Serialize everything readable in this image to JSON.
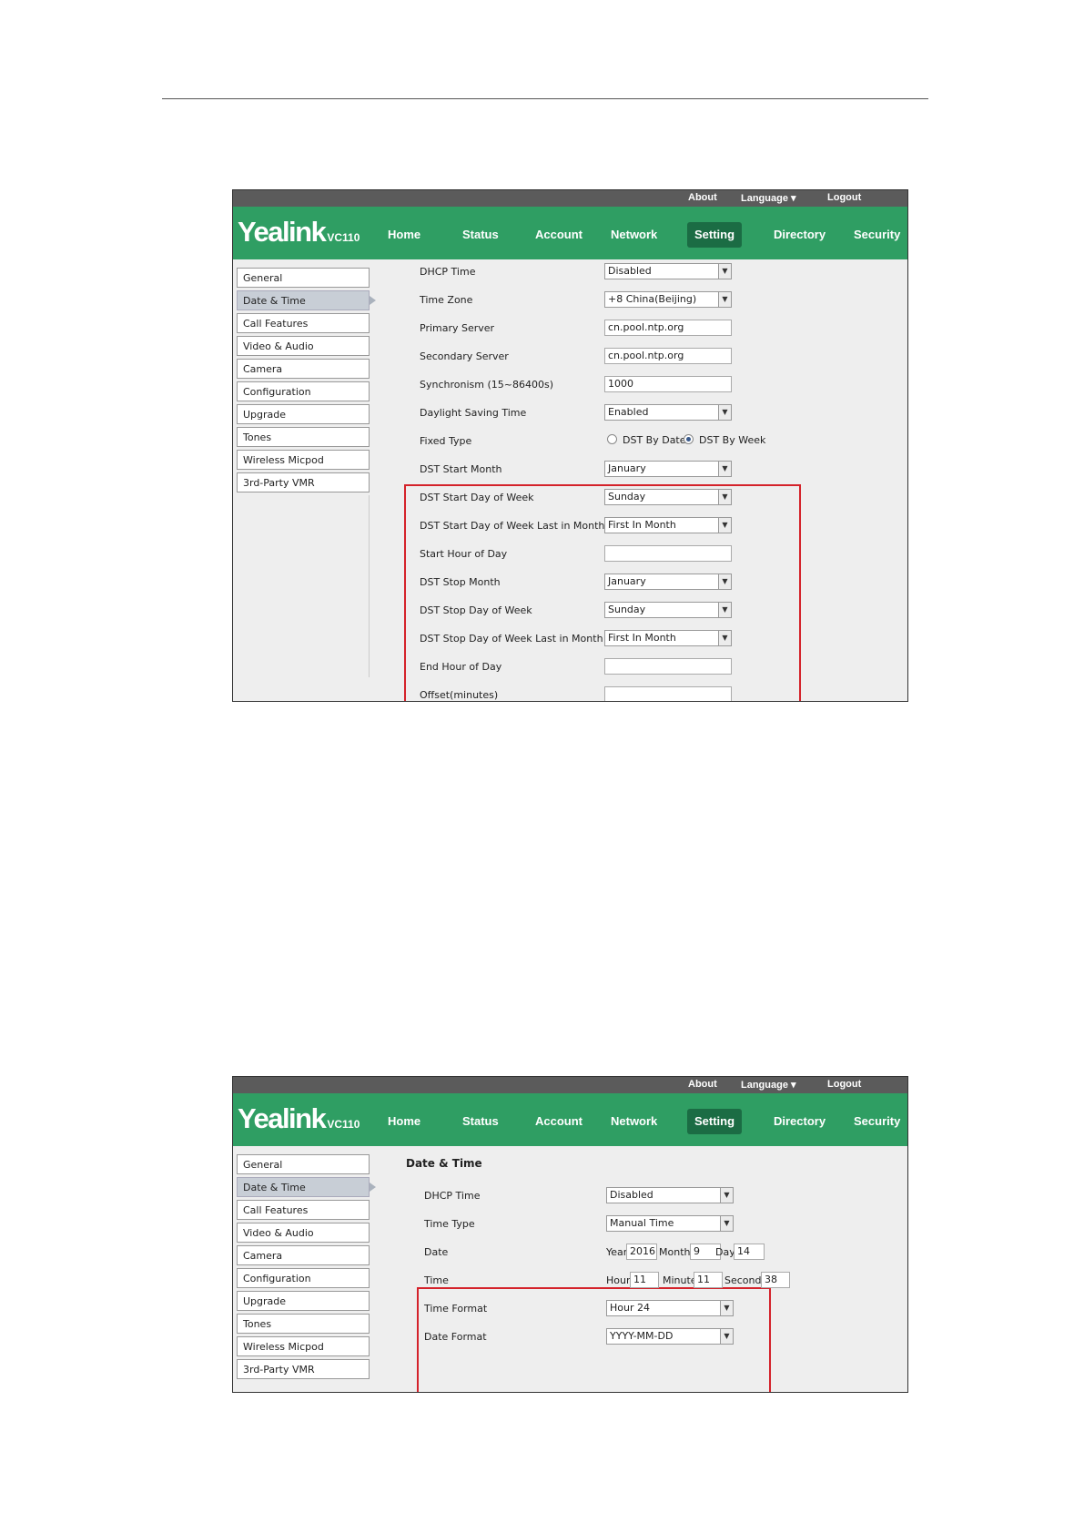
{
  "screenshots": [
    {
      "topbar": {
        "about": "About",
        "language": "Language ▾",
        "logout": "Logout"
      },
      "brand": {
        "logo": "Yealink",
        "model": "VC110"
      },
      "nav": [
        "Home",
        "Status",
        "Account",
        "Network",
        "Setting",
        "Directory",
        "Security"
      ],
      "active_nav": "Setting",
      "sidebar": [
        "General",
        "Date & Time",
        "Call Features",
        "Video & Audio",
        "Camera",
        "Configuration",
        "Upgrade",
        "Tones",
        "Wireless Micpod",
        "3rd-Party VMR"
      ],
      "active_sidebar": "Date & Time",
      "form": {
        "dhcp_time": {
          "label": "DHCP Time",
          "value": "Disabled"
        },
        "time_zone": {
          "label": "Time Zone",
          "value": "+8 China(Beijing)"
        },
        "primary_server": {
          "label": "Primary Server",
          "value": "cn.pool.ntp.org"
        },
        "secondary_server": {
          "label": "Secondary Server",
          "value": "cn.pool.ntp.org"
        },
        "synchronism": {
          "label": "Synchronism (15~86400s)",
          "value": "1000"
        },
        "daylight_saving": {
          "label": "Daylight Saving Time",
          "value": "Enabled"
        },
        "fixed_type": {
          "label": "Fixed Type",
          "option_date": "DST By Date",
          "option_week": "DST By Week",
          "selected": "DST By Week"
        },
        "dst_start_month": {
          "label": "DST Start Month",
          "value": "January"
        },
        "dst_start_dow": {
          "label": "DST Start Day of Week",
          "value": "Sunday"
        },
        "dst_start_dow_last": {
          "label": "DST Start Day of Week Last in Month",
          "value": "First In Month"
        },
        "start_hour": {
          "label": "Start Hour of Day",
          "value": ""
        },
        "dst_stop_month": {
          "label": "DST Stop Month",
          "value": "January"
        },
        "dst_stop_dow": {
          "label": "DST Stop Day of Week",
          "value": "Sunday"
        },
        "dst_stop_dow_last": {
          "label": "DST Stop Day of Week Last in Month",
          "value": "First In Month"
        },
        "end_hour": {
          "label": "End Hour of Day",
          "value": ""
        },
        "offset": {
          "label": "Offset(minutes)",
          "value": ""
        }
      }
    },
    {
      "topbar": {
        "about": "About",
        "language": "Language ▾",
        "logout": "Logout"
      },
      "brand": {
        "logo": "Yealink",
        "model": "VC110"
      },
      "nav": [
        "Home",
        "Status",
        "Account",
        "Network",
        "Setting",
        "Directory",
        "Security"
      ],
      "active_nav": "Setting",
      "sidebar": [
        "General",
        "Date & Time",
        "Call Features",
        "Video & Audio",
        "Camera",
        "Configuration",
        "Upgrade",
        "Tones",
        "Wireless Micpod",
        "3rd-Party VMR"
      ],
      "active_sidebar": "Date & Time",
      "section_title": "Date & Time",
      "form": {
        "dhcp_time": {
          "label": "DHCP Time",
          "value": "Disabled"
        },
        "time_type": {
          "label": "Time Type",
          "value": "Manual Time"
        },
        "date": {
          "label": "Date",
          "year_label": "Year",
          "year": "2016",
          "month_label": "Month",
          "month": "9",
          "day_label": "Day",
          "day": "14"
        },
        "time": {
          "label": "Time",
          "hour_label": "Hour",
          "hour": "11",
          "minute_label": "Minute",
          "minute": "11",
          "second_label": "Second",
          "second": "38"
        },
        "time_format": {
          "label": "Time Format",
          "value": "Hour 24"
        },
        "date_format": {
          "label": "Date Format",
          "value": "YYYY-MM-DD"
        }
      }
    }
  ],
  "colors": {
    "nav_green": "#2f9e63",
    "nav_active": "#1b6c44",
    "highlight_frame": "#d4222a",
    "topbar": "#5b5b5b"
  }
}
